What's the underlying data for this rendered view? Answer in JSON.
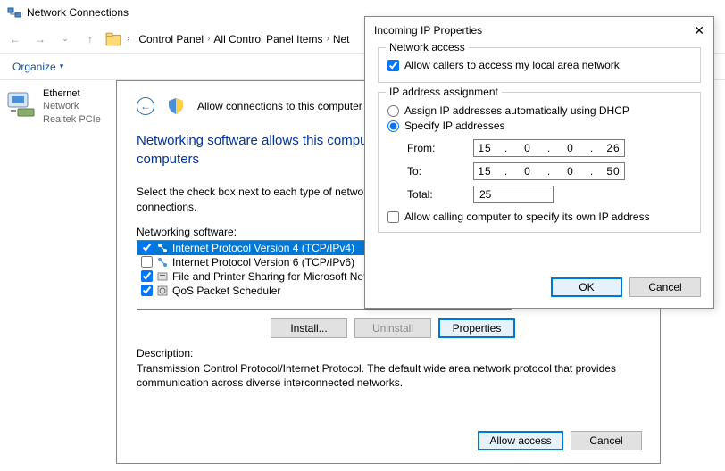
{
  "main": {
    "title": "Network Connections",
    "breadcrumb": [
      "Control Panel",
      "All Control Panel Items",
      "Net"
    ],
    "organize": "Organize"
  },
  "adapter": {
    "name": "Ethernet",
    "status": "Network",
    "device": "Realtek PCIe"
  },
  "wizard": {
    "title": "Allow connections to this computer",
    "heading": "Networking software allows this computer to accept connections from other kinds of computers",
    "text": "Select the check box next to each type of networking software that should be enabled for incoming connections.",
    "software_label": "Networking software:",
    "items": [
      {
        "label": "Internet Protocol Version 4 (TCP/IPv4)",
        "checked": true,
        "selected": true
      },
      {
        "label": "Internet Protocol Version 6 (TCP/IPv6)",
        "checked": false,
        "selected": false
      },
      {
        "label": "File and Printer Sharing for Microsoft Networks",
        "checked": true,
        "selected": false
      },
      {
        "label": "QoS Packet Scheduler",
        "checked": true,
        "selected": false
      }
    ],
    "install": "Install...",
    "uninstall": "Uninstall",
    "properties": "Properties",
    "desc_label": "Description:",
    "desc_text": "Transmission Control Protocol/Internet Protocol. The default wide area network protocol that provides communication across diverse interconnected networks.",
    "allow_access": "Allow access",
    "cancel": "Cancel"
  },
  "dialog": {
    "title": "Incoming IP Properties",
    "net_access": "Network access",
    "allow_callers": "Allow callers to access my local area network",
    "ip_assignment": "IP address assignment",
    "dhcp": "Assign IP addresses automatically using DHCP",
    "specify": "Specify IP addresses",
    "from_label": "From:",
    "to_label": "To:",
    "total_label": "Total:",
    "from_ip": [
      "15",
      "0",
      "0",
      "26"
    ],
    "to_ip": [
      "15",
      "0",
      "0",
      "50"
    ],
    "total": "25",
    "allow_calling": "Allow calling computer to specify its own IP address",
    "ok": "OK",
    "cancel": "Cancel"
  }
}
